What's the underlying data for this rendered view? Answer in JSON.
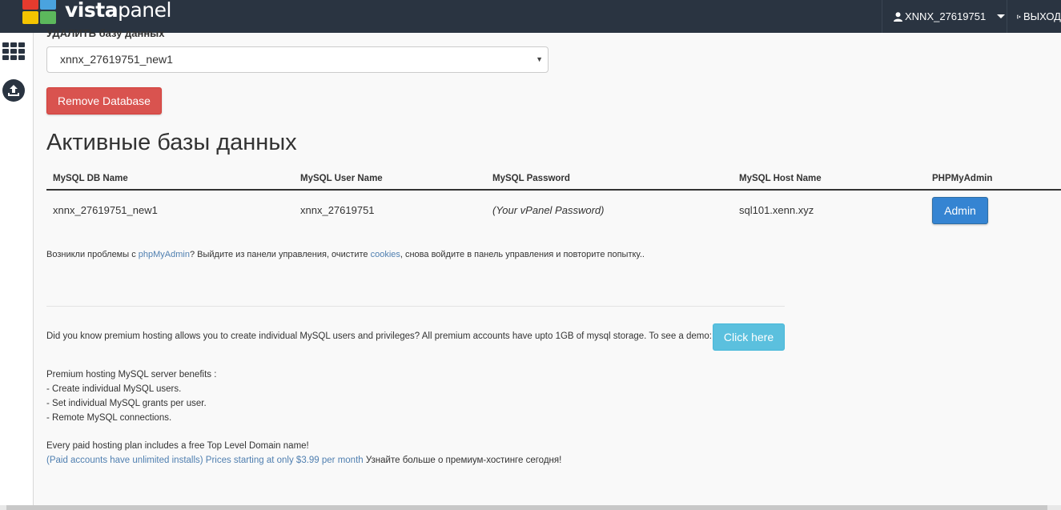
{
  "header": {
    "brand_vista": "vista",
    "brand_panel": "panel",
    "user": "XNNX_27619751",
    "logout": "ВЫХОД"
  },
  "drop_db": {
    "label": "УДАЛИТЬ базу данных",
    "selected": "xnnx_27619751_new1",
    "button": "Remove Database"
  },
  "active": {
    "heading": "Активные базы данных",
    "columns": [
      "MySQL DB Name",
      "MySQL User Name",
      "MySQL Password",
      "MySQL Host Name",
      "PHPMyAdmin"
    ],
    "rows": [
      {
        "db_name": "xnnx_27619751_new1",
        "user_name": "xnnx_27619751",
        "password": "(Your vPanel Password)",
        "host": "sql101.xenn.xyz",
        "action": "Admin"
      }
    ]
  },
  "note": {
    "pre": "Возникли проблемы с ",
    "link1": "phpMyAdmin",
    "mid": "? Выйдите из панели управления, очистите ",
    "link2": "cookies",
    "post": ", снова войдите в панель управления и повторите попытку.."
  },
  "premium": {
    "text": "Did you know premium hosting allows you to create individual MySQL users and privileges? All premium accounts have upto 1GB of mysql storage. To see a demo:",
    "button": "Click here",
    "benefits_title": "Premium hosting MySQL server benefits :",
    "benefits": [
      "- Create individual MySQL users.",
      "- Set individual MySQL grants per user.",
      "- Remote MySQL connections."
    ],
    "tld": "Every paid hosting plan includes a free Top Level Domain name!",
    "link_text": "(Paid accounts have unlimited installs) Prices starting at only $3.99 per month",
    "tail": " Узнайте больше о премиум-хостинге сегодня!"
  },
  "colors": {
    "topbar": "#2a3441",
    "danger": "#d9534f",
    "primary": "#3584d2",
    "info": "#5bc0de",
    "link": "#4f7fb0"
  },
  "icons": {
    "user": "user-icon",
    "logout": "sign-out-icon",
    "apps": "grid-icon",
    "upload": "upload-icon"
  }
}
